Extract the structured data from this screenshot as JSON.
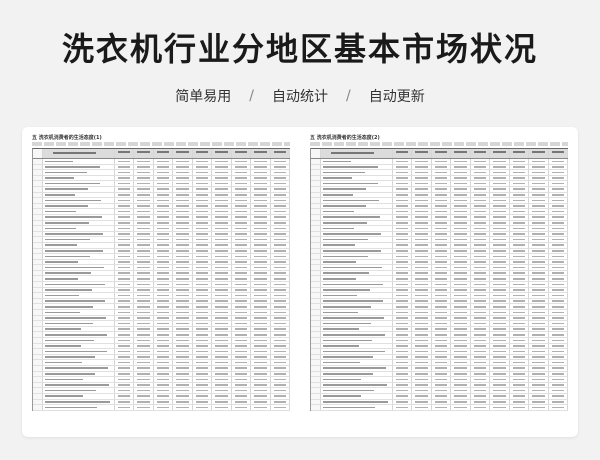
{
  "title": "洗衣机行业分地区基本市场状况",
  "tags": [
    "简单易用",
    "自动统计",
    "自动更新"
  ],
  "separator": "/",
  "sheet": {
    "left_title": "五 洗衣机消费者的生活态度(1)",
    "right_title": "五 洗衣机消费者的生活态度(2)",
    "region_marks": [
      "全",
      "国",
      "华",
      "东",
      "广",
      "深",
      "合",
      "肥",
      "年",
      "成",
      "都",
      "性",
      "别"
    ]
  }
}
